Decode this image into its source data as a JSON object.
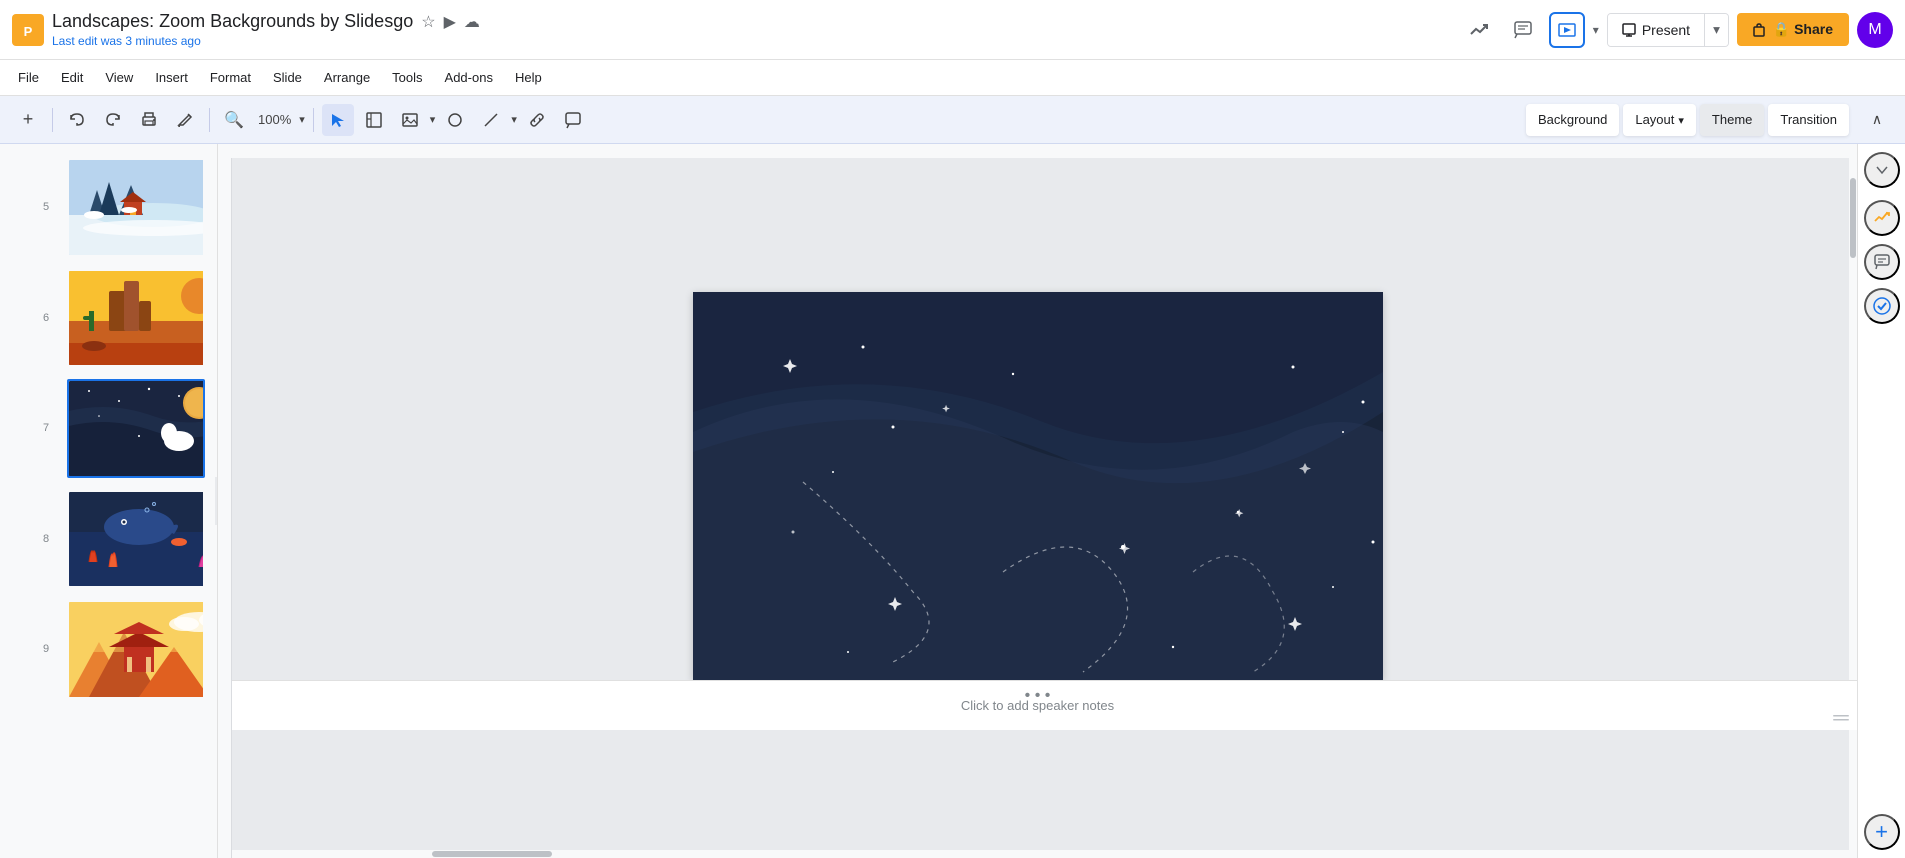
{
  "app": {
    "icon": "🟡",
    "title": "Landscapes: Zoom Backgrounds by Slidesgo",
    "last_edit": "Last edit was 3 minutes ago"
  },
  "header": {
    "star_icon": "☆",
    "drive_icon": "⬜",
    "cloud_icon": "☁",
    "present_label": "Present",
    "present_icon": "▶",
    "present_dropdown": "▾",
    "share_label": "🔒 Share",
    "user_initial": "M",
    "trend_icon": "📈",
    "comment_icon": "💬",
    "slideshow_icon": "⊡"
  },
  "menu": {
    "items": [
      "File",
      "Edit",
      "View",
      "Insert",
      "Format",
      "Slide",
      "Arrange",
      "Tools",
      "Add-ons",
      "Help"
    ],
    "last_edit": "Last edit was 3 minutes ago"
  },
  "toolbar": {
    "add_label": "+",
    "undo_label": "↩",
    "redo_label": "↪",
    "print_label": "🖨",
    "paint_label": "🎨",
    "zoom_label": "🔍",
    "zoom_value": "100%",
    "select_label": "↖",
    "rect_label": "⬜",
    "image_label": "🖼",
    "shape_label": "◯",
    "line_label": "╱",
    "link_label": "⛓",
    "background_label": "Background",
    "layout_label": "Layout",
    "layout_arrow": "▾",
    "theme_label": "Theme",
    "transition_label": "Transition",
    "collapse_label": "∧"
  },
  "slides": [
    {
      "num": 5,
      "type": "winter"
    },
    {
      "num": 6,
      "type": "desert"
    },
    {
      "num": 7,
      "type": "space",
      "active": true
    },
    {
      "num": 8,
      "type": "ocean"
    },
    {
      "num": 9,
      "type": "pavilion"
    }
  ],
  "canvas": {
    "notes_placeholder": "Click to add speaker notes"
  },
  "right_sidebar": {
    "explore_icon": "📈",
    "comment_icon": "💬",
    "check_icon": "✓",
    "add_icon": "+",
    "collapse_label": "∧"
  },
  "colors": {
    "accent_blue": "#1a73e8",
    "accent_yellow": "#f9a825",
    "space_bg": "#1a2540",
    "space_dark": "#0f1a30"
  }
}
